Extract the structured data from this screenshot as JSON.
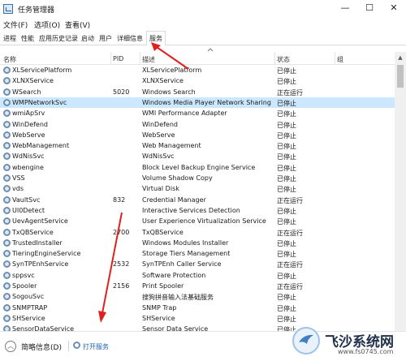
{
  "window": {
    "title": "任务管理器",
    "minimize": "—",
    "maximize": "☐",
    "close": "✕"
  },
  "menu": [
    "文件(F)",
    "选项(O)",
    "查看(V)"
  ],
  "tabs": [
    "进程",
    "性能",
    "应用历史记录",
    "启动",
    "用户",
    "详细信息",
    "服务"
  ],
  "columns": {
    "name": "名称",
    "pid": "PID",
    "description": "描述",
    "status": "状态",
    "group": "组"
  },
  "services": [
    {
      "name": "XLServicePlatform",
      "pid": "",
      "desc": "XLServicePlatform",
      "status": "已停止"
    },
    {
      "name": "XLNXService",
      "pid": "",
      "desc": "XLNXService",
      "status": "已停止"
    },
    {
      "name": "WSearch",
      "pid": "5020",
      "desc": "Windows Search",
      "status": "正在运行"
    },
    {
      "name": "WMPNetworkSvc",
      "pid": "",
      "desc": "Windows Media Player Network Sharing ...",
      "status": "已停止",
      "selected": true
    },
    {
      "name": "wmiApSrv",
      "pid": "",
      "desc": "WMI Performance Adapter",
      "status": "已停止"
    },
    {
      "name": "WinDefend",
      "pid": "",
      "desc": "WinDefend",
      "status": "已停止"
    },
    {
      "name": "WebServe",
      "pid": "",
      "desc": "WebServe",
      "status": "已停止"
    },
    {
      "name": "WebManagement",
      "pid": "",
      "desc": "Web Management",
      "status": "已停止"
    },
    {
      "name": "WdNisSvc",
      "pid": "",
      "desc": "WdNisSvc",
      "status": "已停止"
    },
    {
      "name": "wbengine",
      "pid": "",
      "desc": "Block Level Backup Engine Service",
      "status": "已停止"
    },
    {
      "name": "VSS",
      "pid": "",
      "desc": "Volume Shadow Copy",
      "status": "已停止"
    },
    {
      "name": "vds",
      "pid": "",
      "desc": "Virtual Disk",
      "status": "已停止"
    },
    {
      "name": "VaultSvc",
      "pid": "832",
      "desc": "Credential Manager",
      "status": "正在运行"
    },
    {
      "name": "UI0Detect",
      "pid": "",
      "desc": "Interactive Services Detection",
      "status": "已停止"
    },
    {
      "name": "UevAgentService",
      "pid": "",
      "desc": "User Experience Virtualization Service",
      "status": "已停止"
    },
    {
      "name": "TxQBService",
      "pid": "2700",
      "desc": "TxQBService",
      "status": "正在运行"
    },
    {
      "name": "TrustedInstaller",
      "pid": "",
      "desc": "Windows Modules Installer",
      "status": "已停止"
    },
    {
      "name": "TieringEngineService",
      "pid": "",
      "desc": "Storage Tiers Management",
      "status": "已停止"
    },
    {
      "name": "SynTPEnhService",
      "pid": "2532",
      "desc": "SynTPEnh Caller Service",
      "status": "正在运行"
    },
    {
      "name": "sppsvc",
      "pid": "",
      "desc": "Software Protection",
      "status": "已停止"
    },
    {
      "name": "Spooler",
      "pid": "2156",
      "desc": "Print Spooler",
      "status": "正在运行"
    },
    {
      "name": "SogouSvc",
      "pid": "",
      "desc": "搜狗拼音输入法基础服务",
      "status": "已停止"
    },
    {
      "name": "SNMPTRAP",
      "pid": "",
      "desc": "SNMP Trap",
      "status": "已停止"
    },
    {
      "name": "SHService",
      "pid": "",
      "desc": "SHService",
      "status": "已停止"
    },
    {
      "name": "SensorDataService",
      "pid": "",
      "desc": "Sensor Data Service",
      "status": "已停止"
    }
  ],
  "footer": {
    "fewer_details": "简略信息(D)",
    "open_services": "打开服务"
  },
  "watermark": {
    "text": "飞沙系统网",
    "url": "www.fs0745.com"
  },
  "colors": {
    "selected_row": "#cce8ff",
    "annotation_arrow": "#e02020",
    "link": "#1a5fb4"
  }
}
